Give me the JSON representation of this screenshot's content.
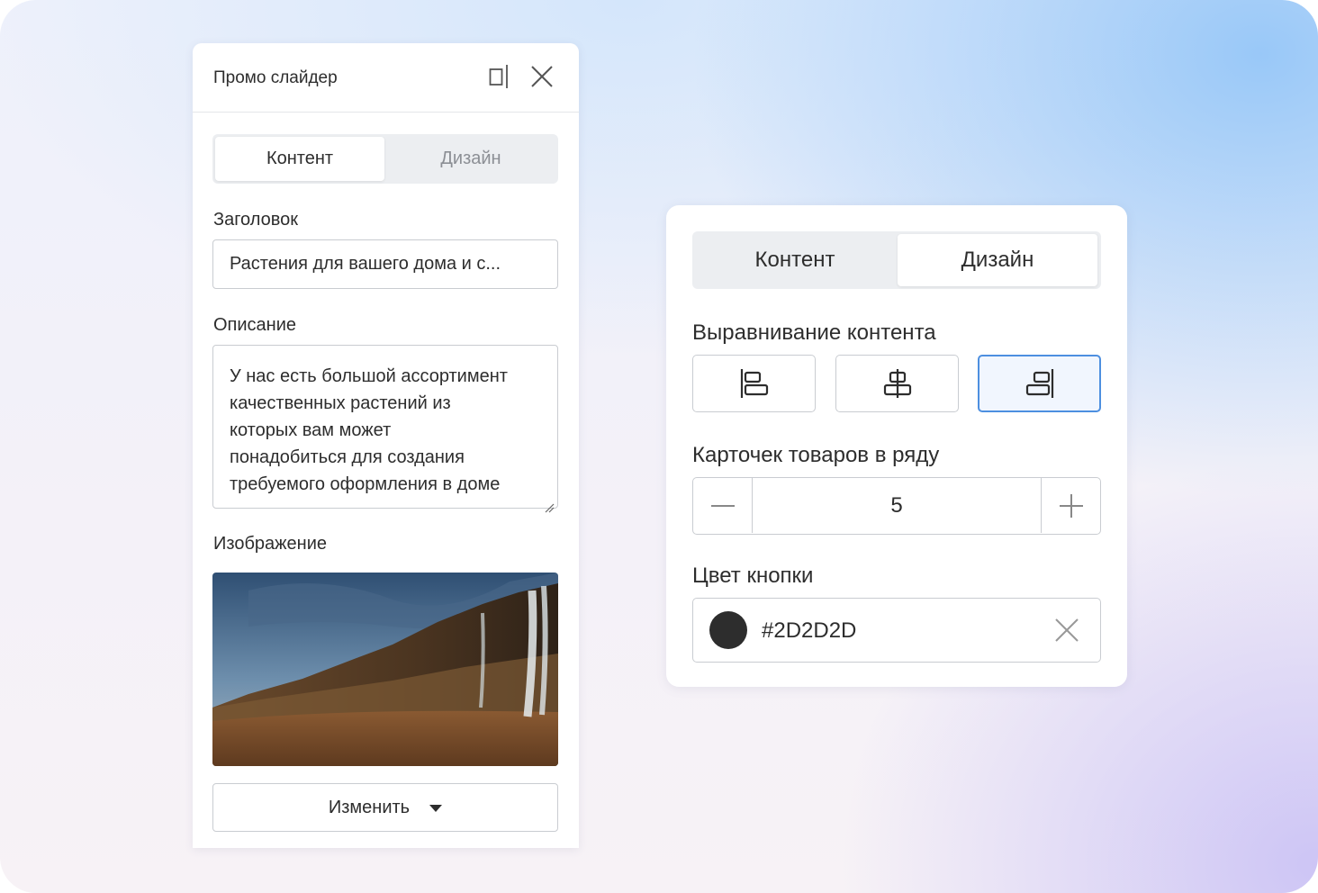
{
  "left_panel": {
    "title": "Промо слайдер",
    "tabs": [
      {
        "label": "Контент",
        "active": true
      },
      {
        "label": "Дизайн",
        "active": false
      }
    ],
    "heading_label": "Заголовок",
    "heading_value": "Растения для вашего дома и с...",
    "description_label": "Описание",
    "description_lines": [
      "У нас есть большой ассортимент",
      "качественных растений из",
      "которых вам может",
      "понадобиться для создания",
      "требуемого оформления в доме"
    ],
    "image_label": "Изображение",
    "change_button": "Изменить"
  },
  "right_panel": {
    "tabs": [
      {
        "label": "Контент",
        "active": false
      },
      {
        "label": "Дизайн",
        "active": true
      }
    ],
    "alignment_label": "Выравнивание контента",
    "alignment_selected": "right",
    "cards_label": "Карточек товаров в ряду",
    "cards_value": "5",
    "button_color_label": "Цвет кнопки",
    "button_color_value": "#2D2D2D"
  },
  "colors": {
    "text": "#2d2d2d",
    "accent": "#4d8fe0",
    "swatch": "#2D2D2D"
  },
  "icons": [
    "dock-panel-icon",
    "close-icon",
    "chevron-down-icon",
    "align-left-icon",
    "align-center-icon",
    "align-right-icon",
    "minus-icon",
    "plus-icon",
    "clear-icon",
    "resize-grip-icon"
  ]
}
